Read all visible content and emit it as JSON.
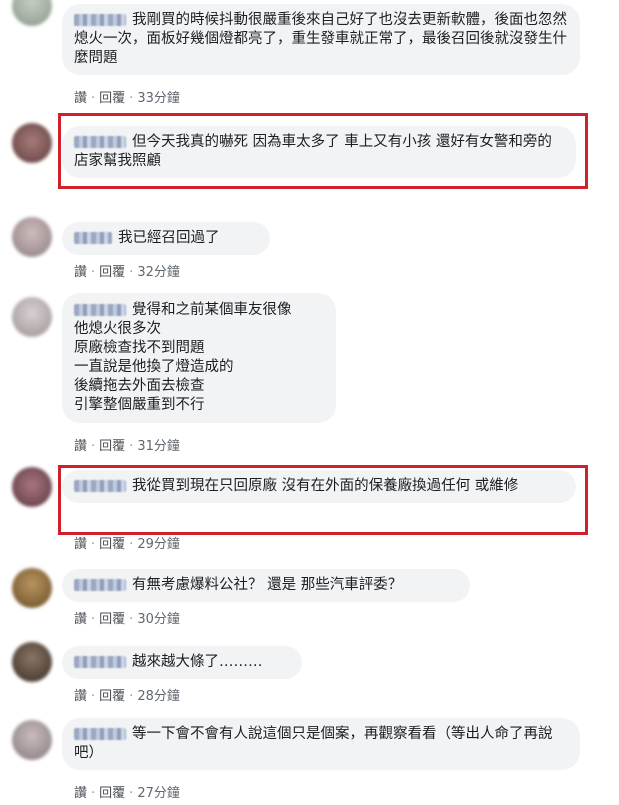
{
  "comments": [
    {
      "text": "我剛買的時候抖動很嚴重後來自己好了也沒去更新軟體，後面也忽然熄火一次，面板好幾個燈都亮了，重生發車就正常了，最後召回後就沒發生什麼問題",
      "like": "讚",
      "reply": "回覆",
      "time": "33分鐘",
      "avatar_color": "#9aa59a"
    },
    {
      "text": "但今天我真的嚇死 因為車太多了 車上又有小孩 還好有女警和旁的店家幫我照顧",
      "highlighted": true,
      "avatar_color": "#7d5a5a"
    },
    {
      "text": "我已經召回過了",
      "like": "讚",
      "reply": "回覆",
      "time": "32分鐘",
      "avatar_color": "#a89a9a"
    },
    {
      "lines": [
        "覺得和之前某個車友很像",
        "他熄火很多次",
        "原廠檢查找不到問題",
        "一直說是他換了燈造成的",
        "後續拖去外面去檢查",
        "引擎整個嚴重到不行"
      ],
      "like": "讚",
      "reply": "回覆",
      "time": "31分鐘",
      "avatar_color": "#b5aeb0"
    },
    {
      "text": "我從買到現在只回原廠 沒有在外面的保養廠換過任何 或維修",
      "highlighted": true,
      "like": "讚",
      "reply": "回覆",
      "time": "29分鐘",
      "avatar_color": "#7a4e56"
    },
    {
      "text": "有無考慮爆料公社？ 還是 那些汽車評委？",
      "like": "讚",
      "reply": "回覆",
      "time": "30分鐘",
      "avatar_color": "#8a6a3e"
    },
    {
      "text": "越來越大條了………",
      "like": "讚",
      "reply": "回覆",
      "time": "28分鐘",
      "avatar_color": "#5a4638"
    },
    {
      "text": "等一下會不會有人說這個只是個案，再觀察看看（等出人命了再說吧）",
      "like": "讚",
      "reply": "回覆",
      "time": "27分鐘",
      "avatar_color": "#9d9090"
    }
  ],
  "colors": {
    "highlight": "#d0202a",
    "bubble": "#f2f3f5"
  }
}
